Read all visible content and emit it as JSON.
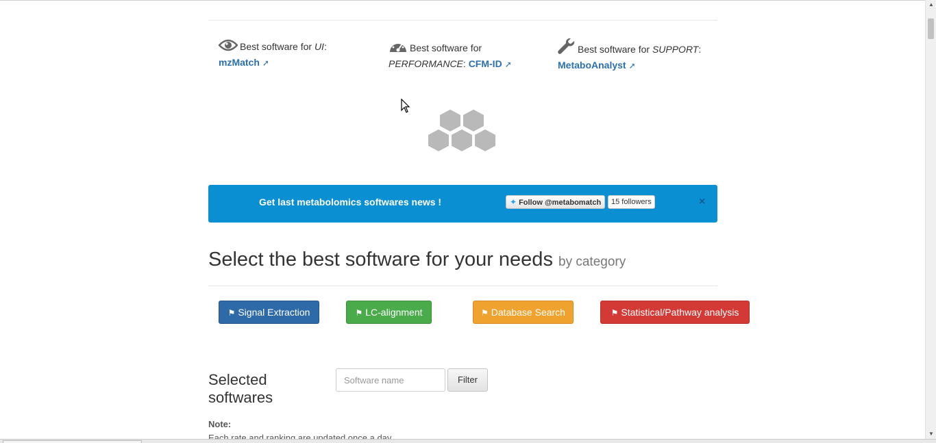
{
  "best_software": [
    {
      "icon": "eye-icon",
      "prefix": "Best software for ",
      "category": "UI",
      "name": "mzMatch"
    },
    {
      "icon": "speedometer-icon",
      "prefix": "Best software for ",
      "category": "PERFORMANCE",
      "name": "CFM-ID"
    },
    {
      "icon": "wrench-icon",
      "prefix": "Best software for ",
      "category": "SUPPORT",
      "name": "MetaboAnalyst"
    }
  ],
  "news_banner": {
    "text": "Get last metabolomics softwares news !",
    "follow_label": "Follow @metabomatch",
    "followers": "15 followers",
    "close_label": "×",
    "background": "#0a8fd3"
  },
  "section": {
    "title": "Select the best software for your needs",
    "subtitle": "by category"
  },
  "categories": [
    {
      "label": "Signal Extraction",
      "color": "#2f6aa8",
      "icon": "tag-icon"
    },
    {
      "label": "LC-alignment",
      "color": "#4aab4a",
      "icon": "tag-icon"
    },
    {
      "label": "Database Search",
      "color": "#f0a22e",
      "icon": "tag-icon"
    },
    {
      "label": "Statistical/Pathway analysis",
      "color": "#d33a35",
      "icon": "tag-icon"
    }
  ],
  "selected": {
    "title": "Selected softwares",
    "search_placeholder": "Software name",
    "filter_label": "Filter"
  },
  "note": {
    "label": "Note:",
    "text": "Each rate and ranking are updated once a day"
  }
}
